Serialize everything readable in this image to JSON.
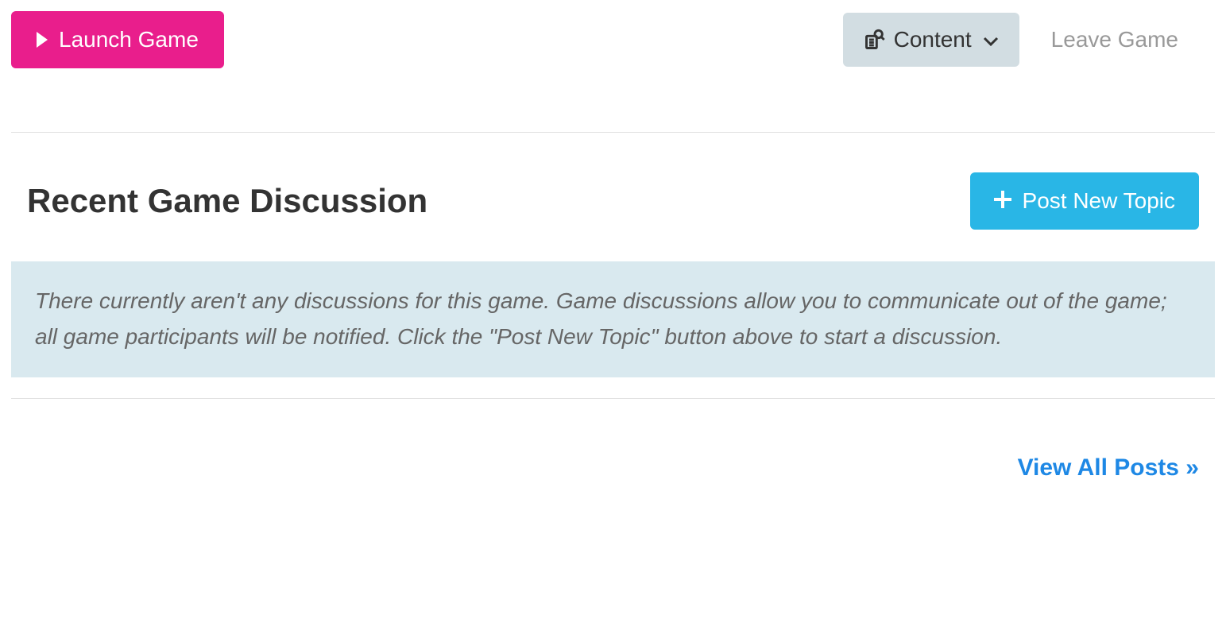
{
  "topbar": {
    "launch_label": "Launch Game",
    "content_label": "Content",
    "leave_label": "Leave Game"
  },
  "discussion": {
    "title": "Recent Game Discussion",
    "post_button_label": "Post New Topic",
    "empty_message": "There currently aren't any discussions for this game. Game discussions allow you to communicate out of the game; all game participants will be notified. Click the \"Post New Topic\" button above to start a discussion."
  },
  "footer": {
    "view_all_label": "View All Posts »"
  }
}
